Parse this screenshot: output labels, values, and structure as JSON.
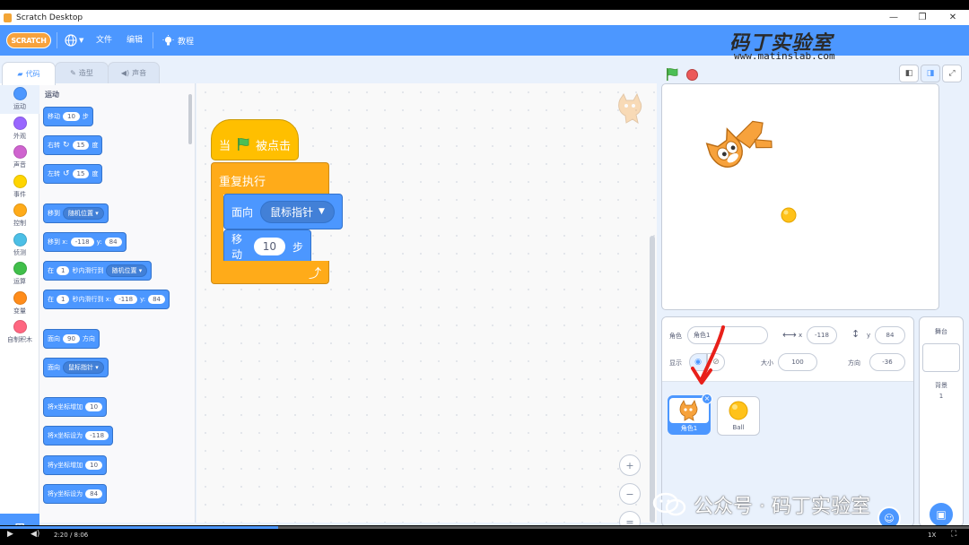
{
  "window": {
    "title": "Scratch Desktop",
    "minimize": "—",
    "maximize": "❐",
    "close": "✕"
  },
  "menubar": {
    "logo": "SCRATCH",
    "globe_icon": "globe-icon",
    "file": "文件",
    "edit": "编辑",
    "tutorials": "教程"
  },
  "watermark": {
    "title": "码丁实验室",
    "url": "www.matinslab.com",
    "corner": "公众号 · 码丁实验室"
  },
  "tabs": [
    {
      "label": "代码",
      "icon": "code-icon"
    },
    {
      "label": "造型",
      "icon": "brush-icon"
    },
    {
      "label": "声音",
      "icon": "speaker-icon"
    }
  ],
  "categories": [
    {
      "label": "运动",
      "color": "#4c97ff"
    },
    {
      "label": "外观",
      "color": "#9966ff"
    },
    {
      "label": "声音",
      "color": "#cf63cf"
    },
    {
      "label": "事件",
      "color": "#ffd500"
    },
    {
      "label": "控制",
      "color": "#ffab19"
    },
    {
      "label": "侦测",
      "color": "#4cbfe6"
    },
    {
      "label": "运算",
      "color": "#40bf4a"
    },
    {
      "label": "变量",
      "color": "#ff8c1a"
    },
    {
      "label": "自制积木",
      "color": "#ff6680"
    }
  ],
  "palette": {
    "section": "运动",
    "move": {
      "pre": "移动",
      "val": "10",
      "post": "步"
    },
    "turn_right": {
      "pre": "右转",
      "val": "15",
      "post": "度"
    },
    "turn_left": {
      "pre": "左转",
      "val": "15",
      "post": "度"
    },
    "goto": {
      "pre": "移到",
      "drop": "随机位置"
    },
    "goto_xy": {
      "pre": "移到 x:",
      "x": "-118",
      "mid": "y:",
      "y": "84"
    },
    "glide": {
      "pre": "在",
      "val": "1",
      "mid": "秒内滑行到",
      "drop": "随机位置"
    },
    "glide_xy": {
      "pre": "在",
      "val": "1",
      "mid": "秒内滑行到 x:",
      "x": "-118",
      "ymid": "y:",
      "y": "84"
    },
    "point_dir": {
      "pre": "面向",
      "val": "90",
      "post": "方向"
    },
    "point_towards": {
      "pre": "面向",
      "drop": "鼠标指针"
    },
    "change_x": {
      "pre": "将x坐标增加",
      "val": "10"
    },
    "set_x": {
      "pre": "将x坐标设为",
      "val": "-118"
    },
    "change_y": {
      "pre": "将y坐标增加",
      "val": "10"
    },
    "set_y": {
      "pre": "将y坐标设为",
      "val": "84"
    }
  },
  "script": {
    "hat": {
      "pre": "当",
      "post": "被点击"
    },
    "forever": "重复执行",
    "point": {
      "pre": "面向",
      "drop": "鼠标指针"
    },
    "move": {
      "pre": "移动",
      "val": "10",
      "post": "步"
    }
  },
  "zoom": {
    "in": "+",
    "out": "−",
    "reset": "="
  },
  "sprite_info": {
    "sprite_label": "角色",
    "sprite_name": "角色1",
    "x_label": "x",
    "x": "-118",
    "y_label": "y",
    "y": "84",
    "show_label": "显示",
    "size_label": "大小",
    "size": "100",
    "dir_label": "方向",
    "direction": "-36"
  },
  "sprites": [
    {
      "name": "角色1",
      "selected": true
    },
    {
      "name": "Ball",
      "selected": false
    }
  ],
  "stage_panel": {
    "title": "舞台",
    "backdrop_label": "背景",
    "backdrop_count": "1"
  },
  "video": {
    "time": "2:20 / 8:06",
    "speed": "1X"
  }
}
